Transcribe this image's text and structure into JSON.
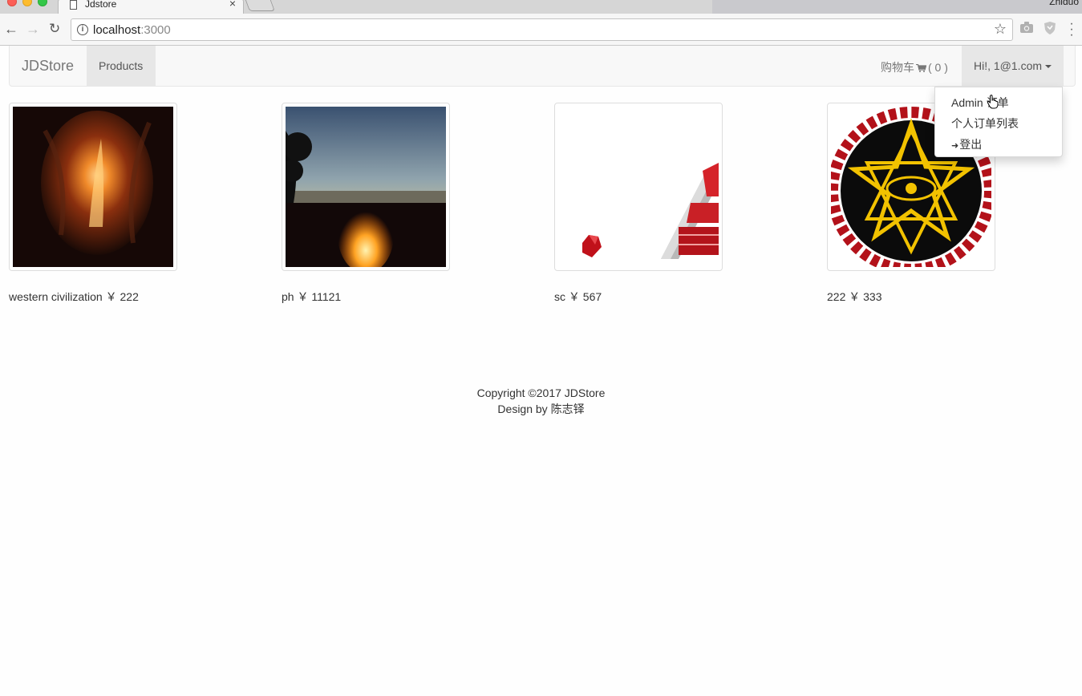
{
  "browser": {
    "tab_title": "Jdstore",
    "tab_close": "×",
    "profile_name": "Zhiduo",
    "url_host": "localhost",
    "url_port": ":3000"
  },
  "navbar": {
    "brand": "JDStore",
    "products": "Products",
    "cart_label": "购物车",
    "cart_count": "( 0 )",
    "user_label": "Hi!, 1@1.com"
  },
  "dropdown": {
    "admin": "Admin 订单",
    "orders": "个人订单列表",
    "logout": "登出"
  },
  "products": [
    {
      "name": "western civilization",
      "price": "￥ 222"
    },
    {
      "name": "ph",
      "price": "￥ 11121"
    },
    {
      "name": "sc",
      "price": "￥ 567"
    },
    {
      "name": "222",
      "price": "￥ 333"
    }
  ],
  "footer": {
    "copyright": "Copyright ©2017 JDStore",
    "design": "Design by 陈志铎"
  },
  "colors": {
    "navbar_bg": "#f8f8f8",
    "active_nav_bg": "#e7e7e7",
    "brand_text": "#777777"
  }
}
